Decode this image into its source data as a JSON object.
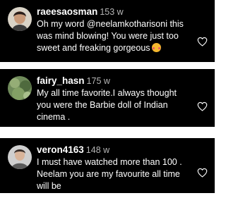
{
  "comments": [
    {
      "username": "raeesaosman",
      "time": "153 w",
      "text": "Oh my word @neelamkotharisoni this was mind blowing! You were just too sweet and freaking gorgeous",
      "emoji": "blush-face-emoji",
      "avatar": "avatar-raeesaosman",
      "like_icon": "heart-outline-icon"
    },
    {
      "username": "fairy_hasn",
      "time": "175 w",
      "text": "My all time favorite.I always thought you were the Barbie doll of Indian cinema .",
      "avatar": "avatar-fairy-hasn",
      "like_icon": "heart-outline-icon"
    },
    {
      "username": "veron4163",
      "time": "148 w",
      "text": "I must have watched more than 100 . Neelam you are my favourite all time will be",
      "avatar": "avatar-veron4163",
      "like_icon": "heart-outline-icon"
    }
  ],
  "colors": {
    "card_bg": "#000000",
    "page_bg": "#ffffff",
    "text": "#ffffff",
    "time": "#b5b5b5"
  }
}
